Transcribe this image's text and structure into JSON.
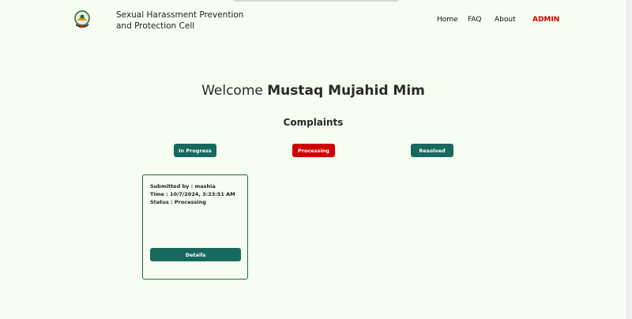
{
  "header": {
    "brand_line1": "Sexual Harassment Prevention",
    "brand_line2": "and Protection Cell",
    "logo_icon": "university-emblem-icon",
    "nav": {
      "home": "Home",
      "faq": "FAQ",
      "about": "About",
      "admin": "ADMIN"
    }
  },
  "welcome": {
    "prefix": "Welcome",
    "name": "Mustaq Mujahid Mim"
  },
  "complaints": {
    "title": "Complaints",
    "filters": {
      "in_progress": "In Progress",
      "processing": "Processing",
      "resolved": "Resolved"
    },
    "items": [
      {
        "submitted_by": "Submitted by : mashia",
        "time": "Time : 10/7/2024, 3:23:51 AM",
        "status": "Status : Processing",
        "details_label": "Details"
      }
    ]
  },
  "colors": {
    "background": "#f6fdf1",
    "primary": "#17695e",
    "danger": "#d10000",
    "admin_link": "#d10000"
  }
}
